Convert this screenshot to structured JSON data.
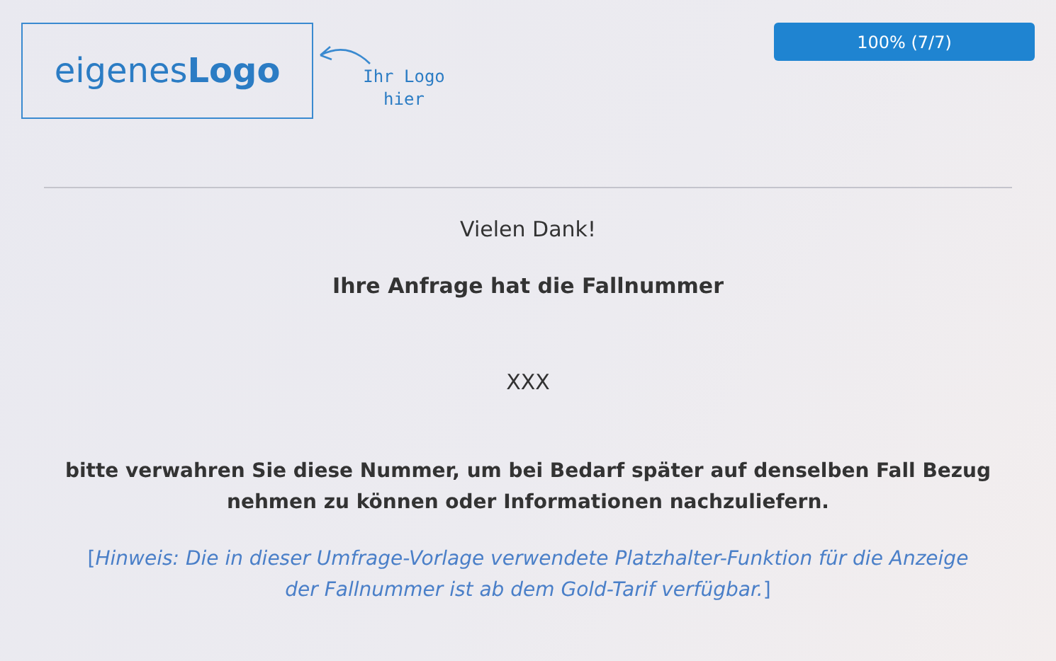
{
  "logo": {
    "text": "eigenes**Logo**",
    "hint": "Ihr Logo hier"
  },
  "progress": {
    "label": "100% (7/7)",
    "level": 1
  },
  "content": {
    "thanks": "Vielen Dank!",
    "case_intro": "Ihre Anfrage hat die Fallnummer",
    "case_number": "XXX",
    "instructions": "bitte verwahren Sie diese Nummer, um bei Bedarf später auf denselben Fall Bezug nehmen zu können oder Informationen nachzuliefern.",
    "note": "[*Hinweis: Die in dieser Umfrage-Vorlage verwendete Platzhalter-Funktion für die Anzeige der Fallnummer ist ab dem Gold-Tarif verfügbar.*]"
  }
}
